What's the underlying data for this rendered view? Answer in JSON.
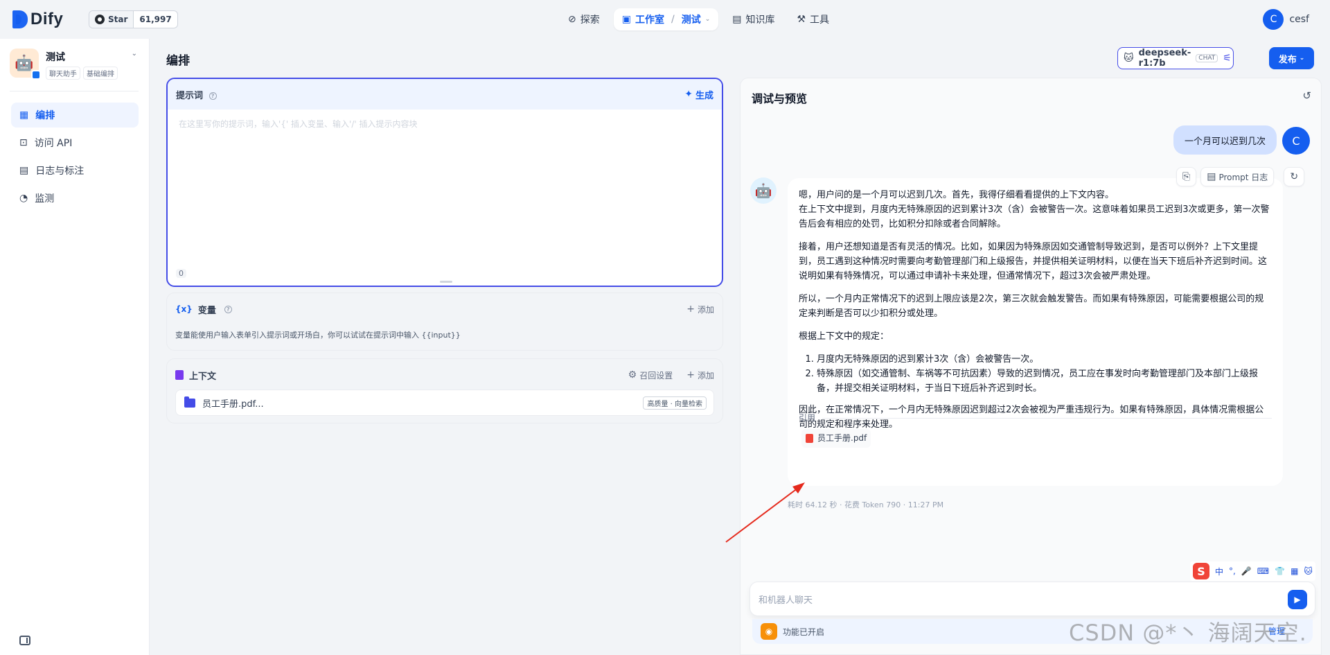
{
  "header": {
    "brand": "Dify",
    "github": {
      "star_label": "Star",
      "count": "61,997"
    },
    "nav": [
      {
        "label": "探索"
      },
      {
        "label": "工作室",
        "sub": "测试"
      },
      {
        "label": "知识库"
      },
      {
        "label": "工具"
      }
    ],
    "user": {
      "initial": "C",
      "name": "cesf"
    }
  },
  "sidebar": {
    "app": {
      "name": "测试",
      "tags": [
        "聊天助手",
        "基础编排"
      ]
    },
    "items": [
      {
        "label": "编排",
        "active": true
      },
      {
        "label": "访问 API"
      },
      {
        "label": "日志与标注"
      },
      {
        "label": "监测"
      }
    ]
  },
  "main": {
    "title": "编排",
    "model": {
      "name": "deepseek-r1:7b",
      "mode": "CHAT"
    },
    "publish_label": "发布"
  },
  "prompt": {
    "title": "提示词",
    "generate_label": "生成",
    "placeholder": "在这里写你的提示词，输入'{' 插入变量、输入'/' 插入提示内容块",
    "count": "0"
  },
  "variables": {
    "title": "变量",
    "add_label": "添加",
    "description": "变量能使用户输入表单引入提示词或开场白，你可以试试在提示词中输入 {{input}}"
  },
  "context": {
    "title": "上下文",
    "recall_label": "召回设置",
    "add_label": "添加",
    "item": {
      "name": "员工手册.pdf...",
      "badge": "高质量 · 向量检索"
    }
  },
  "debug": {
    "title": "调试与预览",
    "user_initial": "C",
    "user_message": "一个月可以迟到几次",
    "toolbar": {
      "prompt_log": "Prompt 日志"
    },
    "answer": {
      "paragraphs": [
        "嗯，用户问的是一个月可以迟到几次。首先，我得仔细看看提供的上下文内容。\n在上下文中提到，月度内无特殊原因的迟到累计3次（含）会被警告一次。这意味着如果员工迟到3次或更多，第一次警告后会有相应的处罚，比如积分扣除或者合同解除。",
        "接着，用户还想知道是否有灵活的情况。比如，如果因为特殊原因如交通管制导致迟到，是否可以例外？上下文里提到，员工遇到这种情况时需要向考勤管理部门和上级报告，并提供相关证明材料，以便在当天下班后补齐迟到时间。这说明如果有特殊情况，可以通过申请补卡来处理，但通常情况下，超过3次会被严肃处理。",
        "所以，一个月内正常情况下的迟到上限应该是2次，第三次就会触发警告。而如果有特殊原因，可能需要根据公司的规定来判断是否可以少扣积分或处理。",
        "根据上下文中的规定："
      ],
      "list": [
        "月度内无特殊原因的迟到累计3次（含）会被警告一次。",
        "特殊原因（如交通管制、车祸等不可抗因素）导致的迟到情况，员工应在事发时向考勤管理部门及本部门上级报备，并提交相关证明材料，于当日下班后补齐迟到时长。"
      ],
      "conclusion": "因此，在正常情况下，一个月内无特殊原因迟到超过2次会被视为严重违规行为。如果有特殊原因，具体情况需根据公司的规定和程序来处理。",
      "citation_label": "引用",
      "citation_file": "员工手册.pdf"
    },
    "meta": "耗时 64.12 秒 · 花费 Token 790 · 11:27 PM",
    "input_placeholder": "和机器人聊天",
    "feature_label": "功能已开启",
    "manage_label": "管理"
  },
  "overlay": {
    "ime": [
      "S",
      "中",
      "°,",
      "🎤",
      "⌨",
      "👕",
      "▦",
      "🐱"
    ],
    "watermark": "CSDN @*丶 海阔天空."
  },
  "colors": {
    "accent": "#155eef",
    "border_active": "#444ce7"
  }
}
